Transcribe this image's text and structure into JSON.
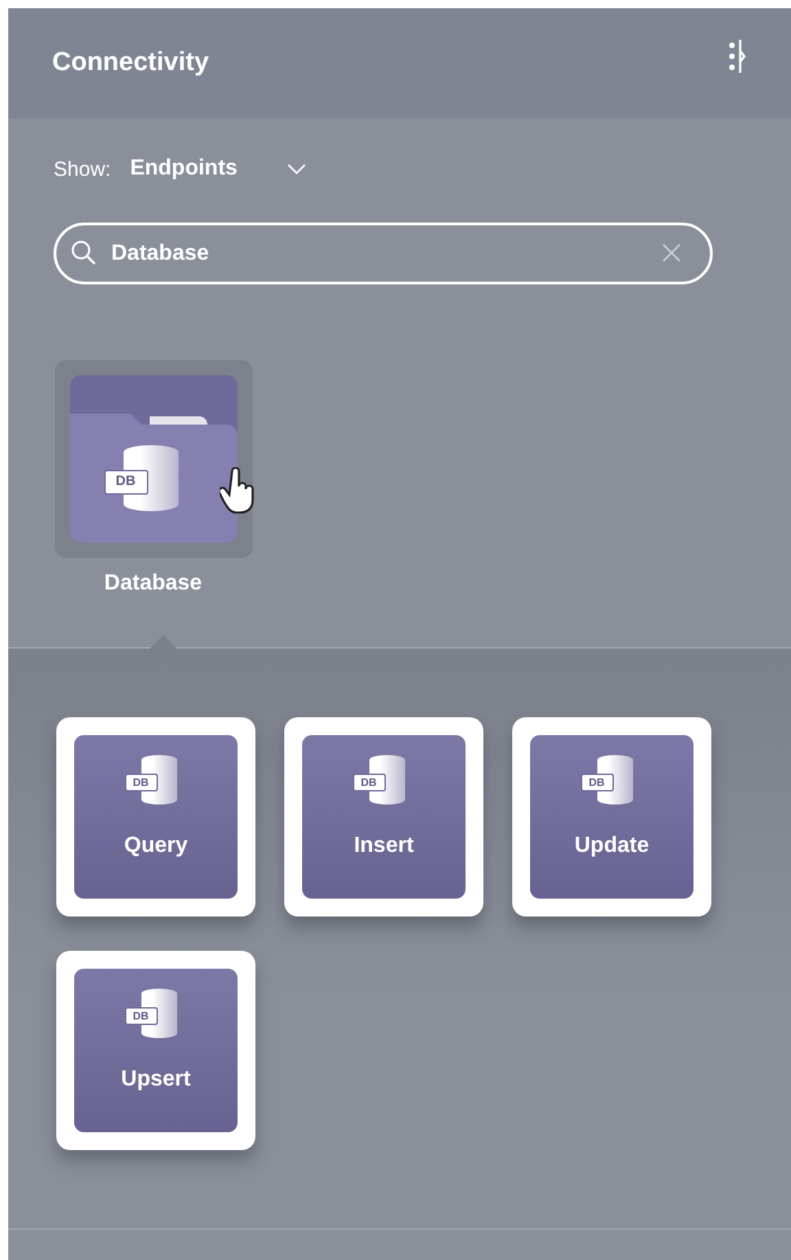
{
  "panel": {
    "title": "Connectivity"
  },
  "filter": {
    "label": "Show:",
    "value": "Endpoints"
  },
  "search": {
    "value": "Database"
  },
  "connectors": [
    {
      "label": "Database",
      "icon_text": "DB",
      "selected": true
    }
  ],
  "actions": [
    {
      "label": "Query",
      "icon_text": "DB"
    },
    {
      "label": "Insert",
      "icon_text": "DB"
    },
    {
      "label": "Update",
      "icon_text": "DB"
    },
    {
      "label": "Upsert",
      "icon_text": "DB"
    }
  ]
}
